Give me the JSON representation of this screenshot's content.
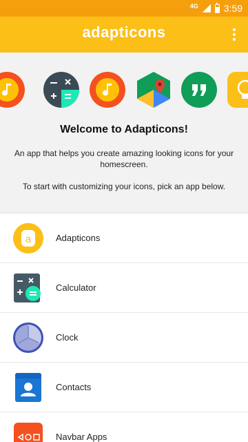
{
  "status_bar": {
    "network": "4G",
    "time": "3:59",
    "colors": {
      "background": "#f59f0d"
    }
  },
  "app_bar": {
    "title": "adapticons",
    "menu_icon": "more-vert-icon",
    "colors": {
      "background": "#fbbf18"
    }
  },
  "header": {
    "carousel_icons": [
      "music-player-orange-icon",
      "calculator-icon",
      "music-player-orange-icon",
      "maps-icon",
      "hangouts-icon",
      "lightbulb-icon"
    ],
    "welcome_title": "Welcome to Adapticons!",
    "description": "An app that helps you create amazing looking icons for your homescreen.",
    "instruction": "To start with customizing your icons, pick an app below."
  },
  "apps": [
    {
      "name": "Adapticons",
      "icon": "adapticons-app-icon"
    },
    {
      "name": "Calculator",
      "icon": "calculator-app-icon"
    },
    {
      "name": "Clock",
      "icon": "clock-app-icon"
    },
    {
      "name": "Contacts",
      "icon": "contacts-app-icon"
    },
    {
      "name": "Navbar Apps",
      "icon": "navbar-apps-icon"
    }
  ]
}
